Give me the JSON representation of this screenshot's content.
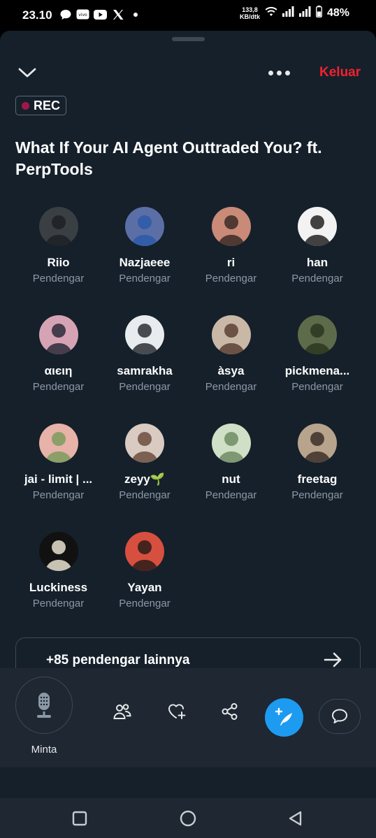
{
  "status_bar": {
    "time": "23.10",
    "network_speed_value": "133,8",
    "network_speed_unit": "KB/dtk",
    "battery": "48%"
  },
  "header": {
    "leave_label": "Keluar",
    "rec_label": "REC"
  },
  "space": {
    "title": "What If Your AI Agent Outtraded You? ft. PerpTools"
  },
  "participants": [
    {
      "name": "Riio",
      "role": "Pendengar"
    },
    {
      "name": "Nazjaeee",
      "role": "Pendengar"
    },
    {
      "name": "ri",
      "role": "Pendengar"
    },
    {
      "name": "han",
      "role": "Pendengar"
    },
    {
      "name": "αιєιη",
      "role": "Pendengar"
    },
    {
      "name": "samrakha",
      "role": "Pendengar"
    },
    {
      "name": "àsya",
      "role": "Pendengar"
    },
    {
      "name": "pickmena...",
      "role": "Pendengar"
    },
    {
      "name": "jai - limit | ...",
      "role": "Pendengar"
    },
    {
      "name": "zeyy🌱",
      "role": "Pendengar"
    },
    {
      "name": "nut",
      "role": "Pendengar"
    },
    {
      "name": "freetag",
      "role": "Pendengar"
    },
    {
      "name": "Luckiness",
      "role": "Pendengar"
    },
    {
      "name": "Yayan",
      "role": "Pendengar"
    }
  ],
  "more_listeners": {
    "label": "+85 pendengar lainnya"
  },
  "toolbar": {
    "mic_label": "Minta"
  },
  "colors": {
    "background": "#15202b",
    "toolbar_bg": "#1e2732",
    "accent": "#1d9bf0",
    "leave": "#f4212e",
    "rec_dot": "#a0184a",
    "secondary_text": "#8b98a5"
  }
}
